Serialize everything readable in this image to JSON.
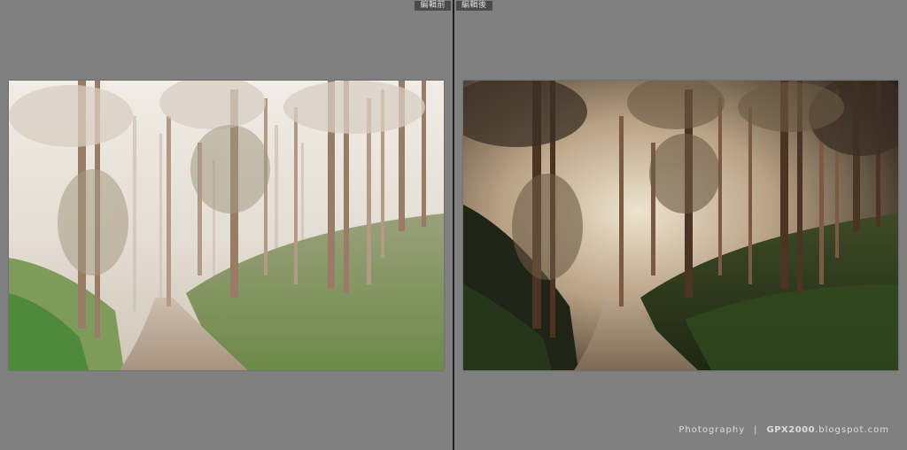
{
  "compare_view": {
    "before_label": "編輯前",
    "after_label": "編輯後"
  },
  "watermark": {
    "left_text": "Photography",
    "separator": "|",
    "brand": "GPX2000",
    "suffix": ".blogspot.com"
  },
  "photos": {
    "before": {
      "tone": "faded",
      "fog": "heavy"
    },
    "after": {
      "tone": "warm-dark",
      "fog": "light"
    }
  }
}
